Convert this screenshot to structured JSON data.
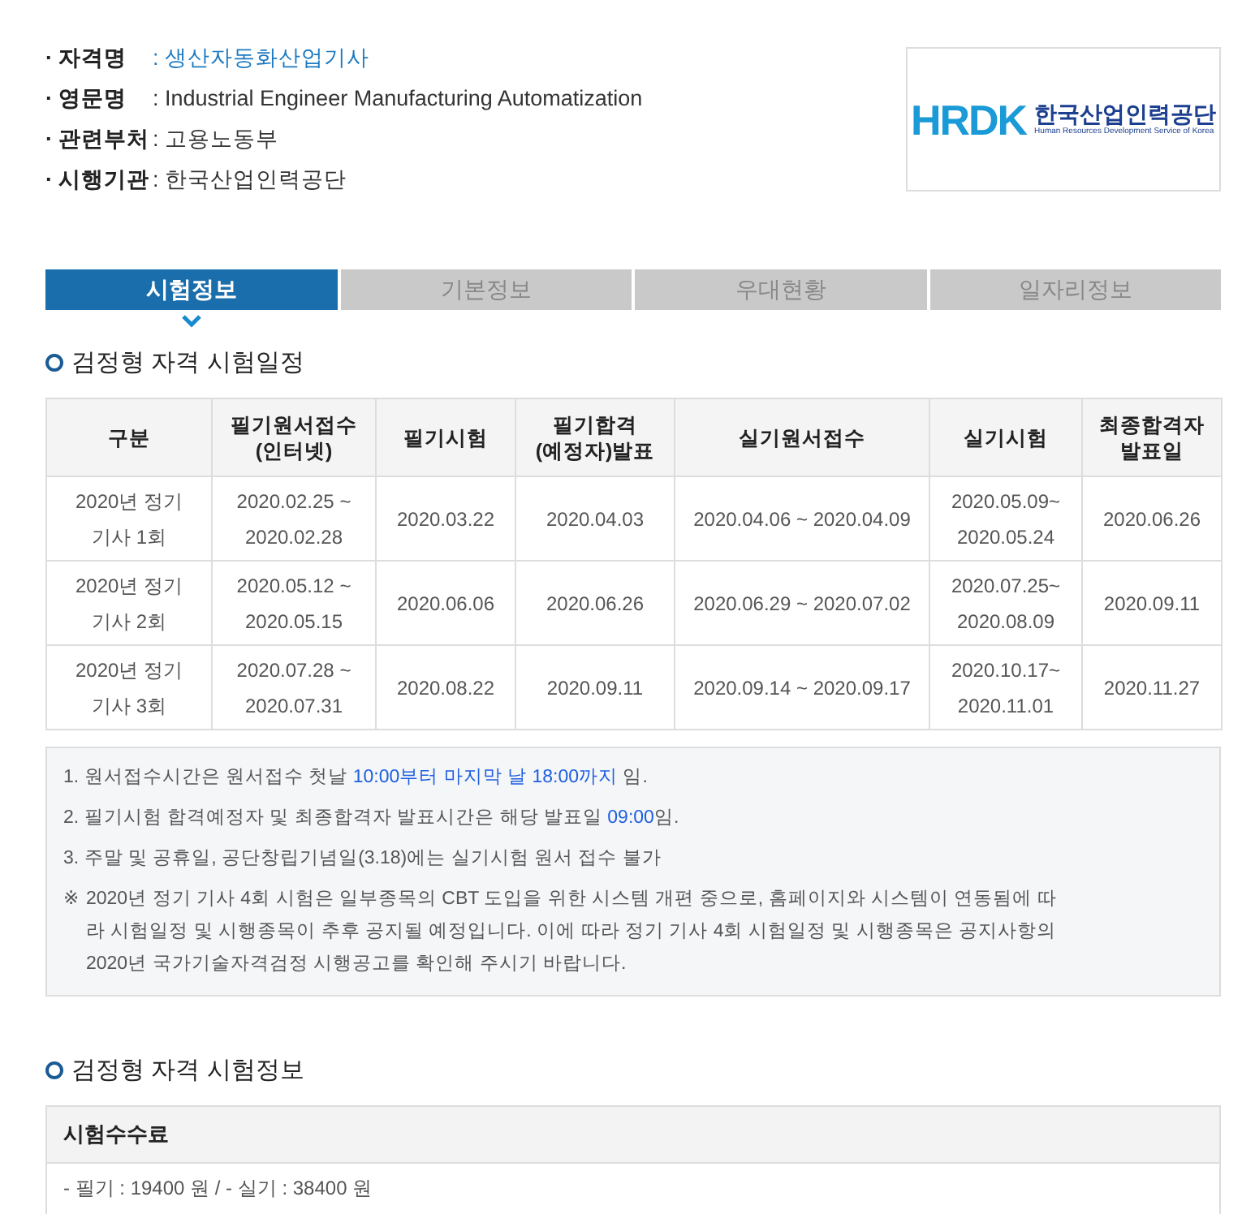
{
  "info": [
    {
      "label": "· 자격명",
      "value": ": 생산자동화산업기사",
      "highlight": true
    },
    {
      "label": "· 영문명",
      "value": ": Industrial Engineer Manufacturing Automatization",
      "highlight": false
    },
    {
      "label": "· 관련부처",
      "value": ": 고용노동부",
      "highlight": false
    },
    {
      "label": "· 시행기관",
      "value": ": 한국산업인력공단",
      "highlight": false
    }
  ],
  "logo": {
    "mark": "HRDK",
    "name": "한국산업인력공단",
    "subtitle": "Human Resources Development Service of Korea"
  },
  "tabs": [
    {
      "label": "시험정보",
      "selected": true
    },
    {
      "label": "기본정보",
      "selected": false
    },
    {
      "label": "우대현황",
      "selected": false
    },
    {
      "label": "일자리정보",
      "selected": false
    }
  ],
  "schedule": {
    "title": "검정형 자격 시험일정",
    "table": {
      "columns": [
        "구분",
        "필기원서접수\n(인터넷)",
        "필기시험",
        "필기합격\n(예정자)발표",
        "실기원서접수",
        "실기시험",
        "최종합격자\n발표일"
      ],
      "rows": [
        [
          "2020년 정기\n기사 1회",
          "2020.02.25 ~\n2020.02.28",
          "2020.03.22",
          "2020.04.03",
          "2020.04.06 ~ 2020.04.09",
          "2020.05.09~\n2020.05.24",
          "2020.06.26"
        ],
        [
          "2020년 정기\n기사 2회",
          "2020.05.12 ~\n2020.05.15",
          "2020.06.06",
          "2020.06.26",
          "2020.06.29 ~ 2020.07.02",
          "2020.07.25~\n2020.08.09",
          "2020.09.11"
        ],
        [
          "2020년 정기\n기사 3회",
          "2020.07.28 ~\n2020.07.31",
          "2020.08.22",
          "2020.09.11",
          "2020.09.14 ~ 2020.09.17",
          "2020.10.17~\n2020.11.01",
          "2020.11.27"
        ]
      ]
    },
    "notes": [
      {
        "segments": [
          {
            "text": "1. 원서접수시간은 원서접수 첫날 ",
            "highlight": false
          },
          {
            "text": "10:00부터 마지막 날 18:00까지",
            "highlight": true
          },
          {
            "text": " 임.",
            "highlight": false
          }
        ]
      },
      {
        "segments": [
          {
            "text": "2. 필기시험 합격예정자 및 최종합격자 발표시간은 해당 발표일 ",
            "highlight": false
          },
          {
            "text": "09:00",
            "highlight": true
          },
          {
            "text": "임.",
            "highlight": false
          }
        ]
      },
      {
        "segments": [
          {
            "text": "3. 주말 및 공휴일, 공단창립기념일(3.18)에는 실기시험 원서 접수 불가",
            "highlight": false
          }
        ]
      }
    ],
    "remark": {
      "mark": "※",
      "text": "2020년 정기 기사 4회 시험은 일부종목의 CBT 도입을 위한 시스템 개편 중으로, 홈페이지와 시스템이 연동됨에 따라 시험일정 및 시행종목이 추후 공지될 예정입니다. 이에 따라 정기 기사 4회 시험일정 및 시행종목은 공지사항의 2020년 국가기술자격검정 시행공고를 확인해 주시기 바랍니다."
    }
  },
  "exam_info": {
    "title": "검정형 자격 시험정보",
    "fee": {
      "heading": "시험수수료",
      "text": "- 필기 : 19400 원 / - 실기 : 38400 원"
    }
  }
}
